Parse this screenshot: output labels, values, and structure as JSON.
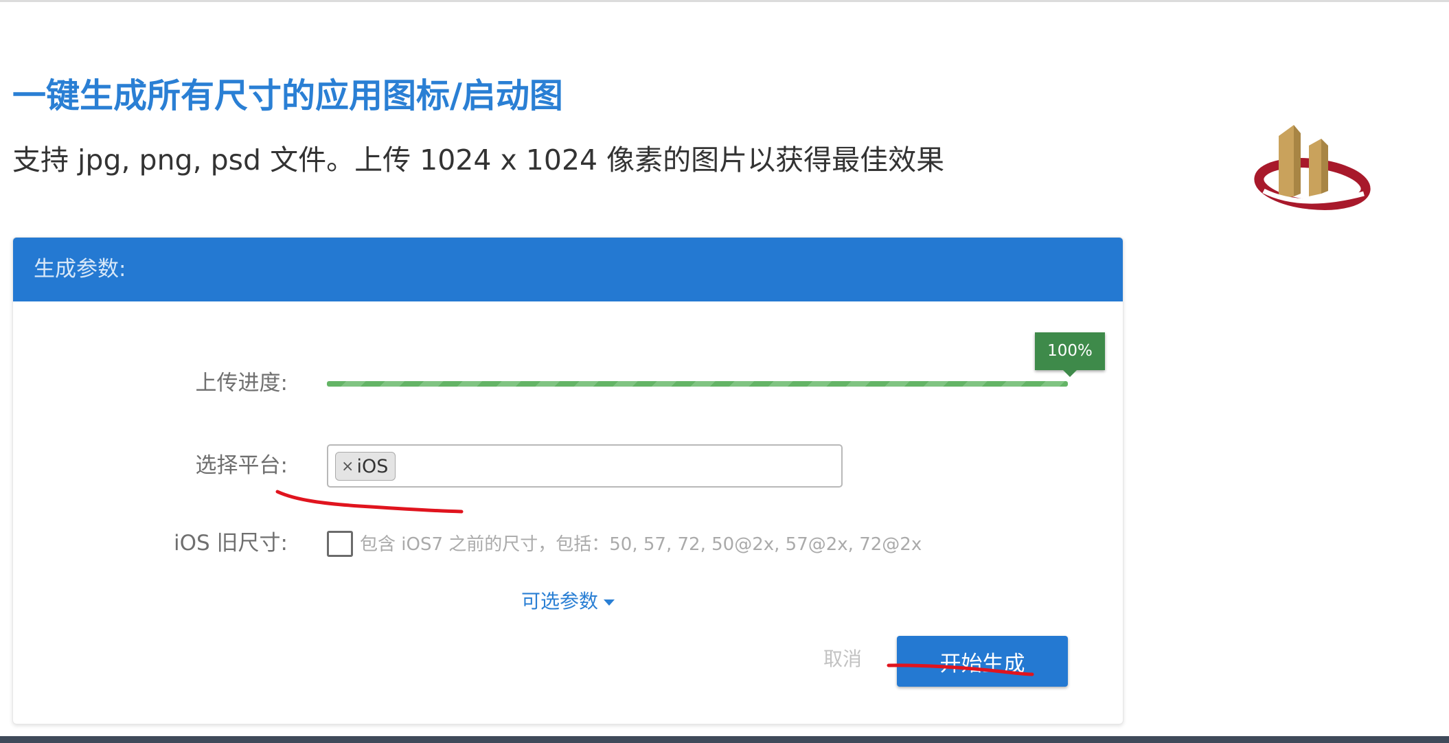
{
  "header": {
    "title": "一键生成所有尺寸的应用图标/启动图",
    "subtitle": "支持 jpg, png, psd 文件。上传 1024 x 1024 像素的图片以获得最佳效果"
  },
  "panel": {
    "title": "生成参数:",
    "progress": {
      "label": "上传进度:",
      "percent_text": "100%",
      "fraction": 1.0
    },
    "platform": {
      "label": "选择平台:",
      "selected_tags": [
        "iOS"
      ],
      "remove_glyph": "×"
    },
    "legacy": {
      "label": "iOS 旧尺寸:",
      "checked": false,
      "description": "包含 iOS7 之前的尺寸，包括：50, 57, 72, 50@2x, 57@2x, 72@2x"
    },
    "optional_params_label": "可选参数",
    "cancel_label": "取消",
    "start_label": "开始生成"
  },
  "colors": {
    "accent": "#2479d2",
    "title_blue": "#2a7fd4",
    "progress_green": "#64b466",
    "tooltip_green": "#3e8a4a",
    "annotation_red": "#e0141e",
    "logo_gold": "#c9a25c",
    "logo_red": "#a8192b"
  }
}
